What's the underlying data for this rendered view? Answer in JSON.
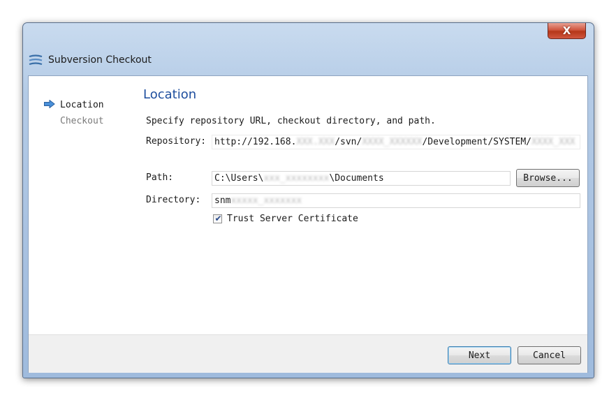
{
  "window": {
    "title": "Subversion Checkout",
    "close_glyph": "X"
  },
  "nav": {
    "items": [
      {
        "label": "Location",
        "active": true
      },
      {
        "label": "Checkout",
        "active": false
      }
    ]
  },
  "page": {
    "title": "Location",
    "description": "Specify repository URL, checkout directory, and path."
  },
  "repository": {
    "label": "Repository:",
    "value_prefix": "http://192.168.",
    "value_blur1": "XXX.XXX",
    "value_mid1": "/svn/",
    "value_blur2": "XXXX_XXXXXX",
    "value_mid2": "/Development/SYSTEM/",
    "value_blur3": "XXXX_XXX"
  },
  "path": {
    "label": "Path:",
    "value_prefix": "C:\\Users\\",
    "value_blur": "xxx_xxxxxxxx",
    "value_suffix": "\\Documents",
    "browse_label": "Browse..."
  },
  "directory": {
    "label": "Directory:",
    "value_prefix": "snm",
    "value_blur": "xxxxx_xxxxxxx"
  },
  "trust": {
    "label": "Trust Server Certificate",
    "checked": true
  },
  "buttons": {
    "next": "Next",
    "cancel": "Cancel"
  },
  "colors": {
    "accent": "#1e4e9e",
    "title_bar": "#b4cbe6",
    "close_button": "#c84a2e"
  },
  "icons": {
    "app": "svn-checkout-icon",
    "nav_active": "arrow-right-icon",
    "close": "close-icon",
    "check": "checkmark-icon"
  }
}
